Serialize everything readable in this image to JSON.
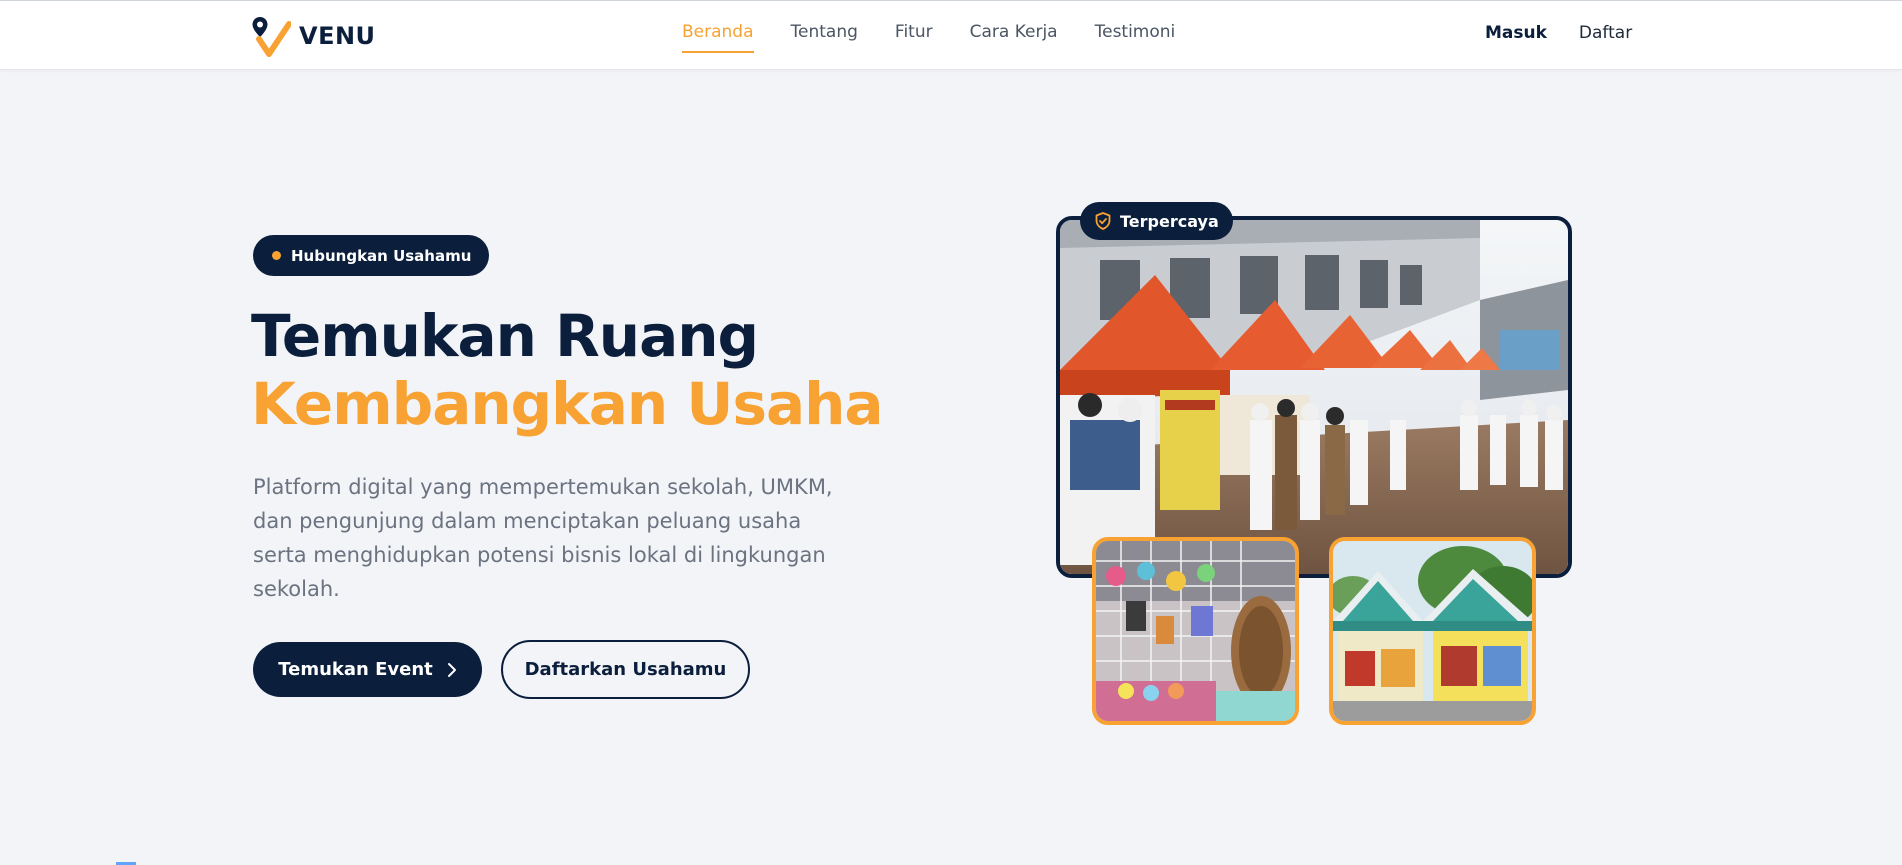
{
  "brand": {
    "name": "VENU",
    "accent": "#f7a232",
    "navy": "#0b1f3d"
  },
  "nav": {
    "items": [
      {
        "label": "Beranda",
        "active": true
      },
      {
        "label": "Tentang",
        "active": false
      },
      {
        "label": "Fitur",
        "active": false
      },
      {
        "label": "Cara Kerja",
        "active": false
      },
      {
        "label": "Testimoni",
        "active": false
      }
    ],
    "login_label": "Masuk",
    "register_label": "Daftar"
  },
  "hero": {
    "badge": "Hubungkan Usahamu",
    "headline_line1": "Temukan Ruang",
    "headline_line2": "Kembangkan Usaha",
    "description": "Platform digital yang mempertemukan sekolah, UMKM, dan pengunjung dalam menciptakan peluang usaha serta menghidupkan potensi bisnis lokal di lingkungan sekolah.",
    "primary_cta": "Temukan Event",
    "secondary_cta": "Daftarkan Usahamu",
    "trust_badge": "Terpercaya"
  },
  "icons": {
    "logo": "location-pin-check-logo",
    "badge_dot": "dot-icon",
    "cta_arrow": "chevron-right-icon",
    "trust": "shield-check-icon"
  }
}
